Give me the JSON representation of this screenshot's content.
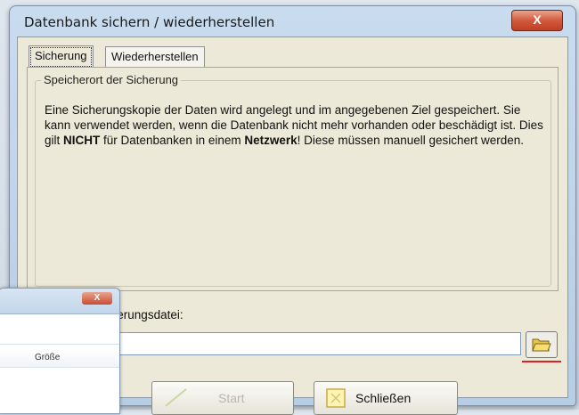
{
  "window": {
    "title": "Datenbank sichern / wiederherstellen",
    "close_label": "X"
  },
  "tabs": [
    {
      "label": "Sicherung",
      "active": true
    },
    {
      "label": "Wiederherstellen",
      "active": false
    }
  ],
  "group": {
    "legend": "Speicherort der Sicherung",
    "desc_part1": "Eine Sicherungskopie der Daten wird angelegt und im angegebenen Ziel gespeichert. Sie kann verwendet werden, wenn die Datenbank nicht mehr vorhanden oder beschädigt ist. Dies gilt ",
    "desc_bold1": "NICHT",
    "desc_part2": " für Datenbanken in einem ",
    "desc_bold2": "Netzwerk",
    "desc_part3": "! Diese müssen manuell gesichert werden."
  },
  "backup_file": {
    "label": "Name der Sicherungsdatei:",
    "value": ""
  },
  "buttons": {
    "start_label": "Start",
    "start_enabled": false,
    "close_label": "Schließen"
  },
  "background_window": {
    "close_label": "X",
    "column_header": "Größe"
  },
  "colors": {
    "title_accent": "#c9dcef",
    "close_red": "#c94b30",
    "highlight_line": "#e02020"
  },
  "icons": {
    "browse": "folder-open-icon",
    "start": "checkmark-icon",
    "close": "exit-icon"
  }
}
